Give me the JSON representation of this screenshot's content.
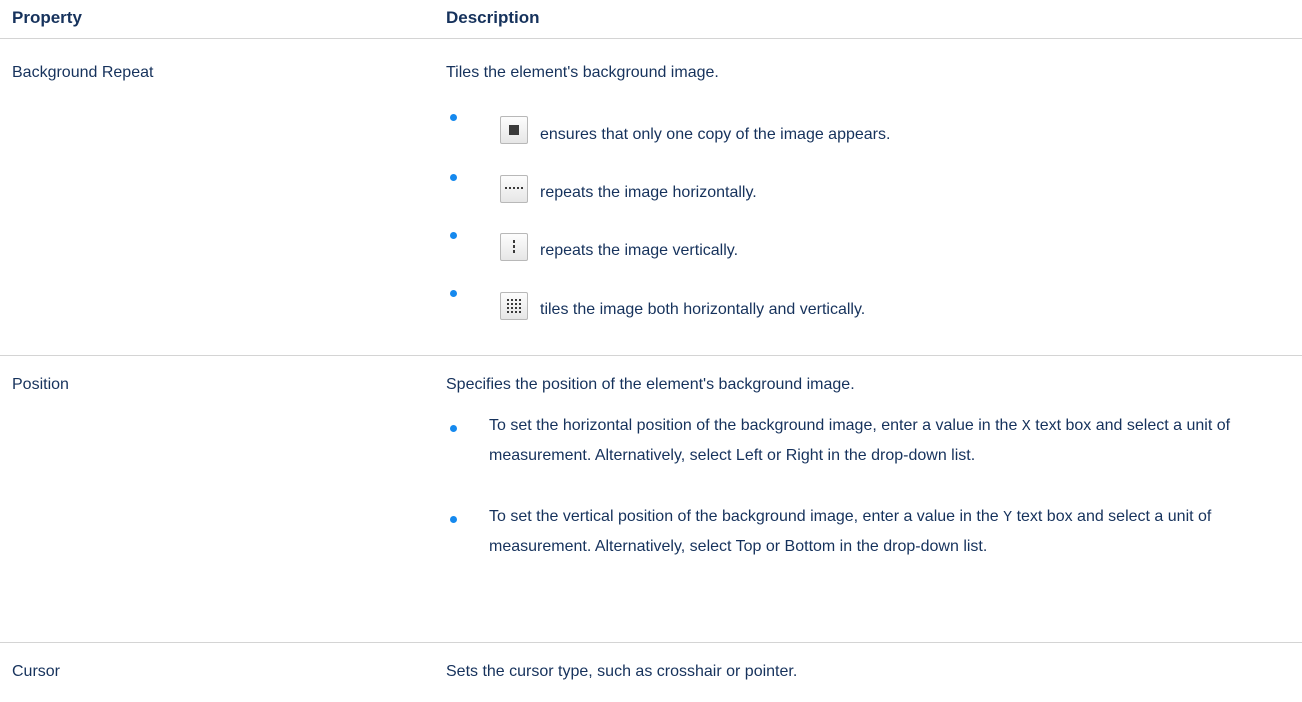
{
  "table": {
    "header": {
      "property": "Property",
      "description": "Description"
    },
    "rows": [
      {
        "property": "Background Repeat",
        "description": "Tiles the element's background image.",
        "items": [
          {
            "icon": "no-repeat-icon",
            "text": "ensures that only one copy of the image appears."
          },
          {
            "icon": "repeat-x-icon",
            "text": "repeats the image horizontally."
          },
          {
            "icon": "repeat-y-icon",
            "text": "repeats the image vertically."
          },
          {
            "icon": "repeat-tile-icon",
            "text": "tiles the image both horizontally and vertically."
          }
        ]
      },
      {
        "property": "Position",
        "description": "Specifies the position of the element's background image.",
        "items": [
          {
            "before": "To set the horizontal position of the background image, enter a value in the",
            "code": "X",
            "after": "text box and select a unit of measurement. Alternatively, select Left or Right in the drop-down list."
          },
          {
            "before": "To set the vertical position of the background image, enter a value in the",
            "code": "Y",
            "after": "text box and select a unit of measurement. Alternatively, select Top or Bottom in the drop-down list."
          }
        ]
      },
      {
        "property": "Cursor",
        "description": "Sets the cursor type, such as crosshair or pointer."
      }
    ]
  },
  "colors": {
    "text": "#16325c",
    "bullet": "#1589ee",
    "rule": "#d4d4d4"
  }
}
